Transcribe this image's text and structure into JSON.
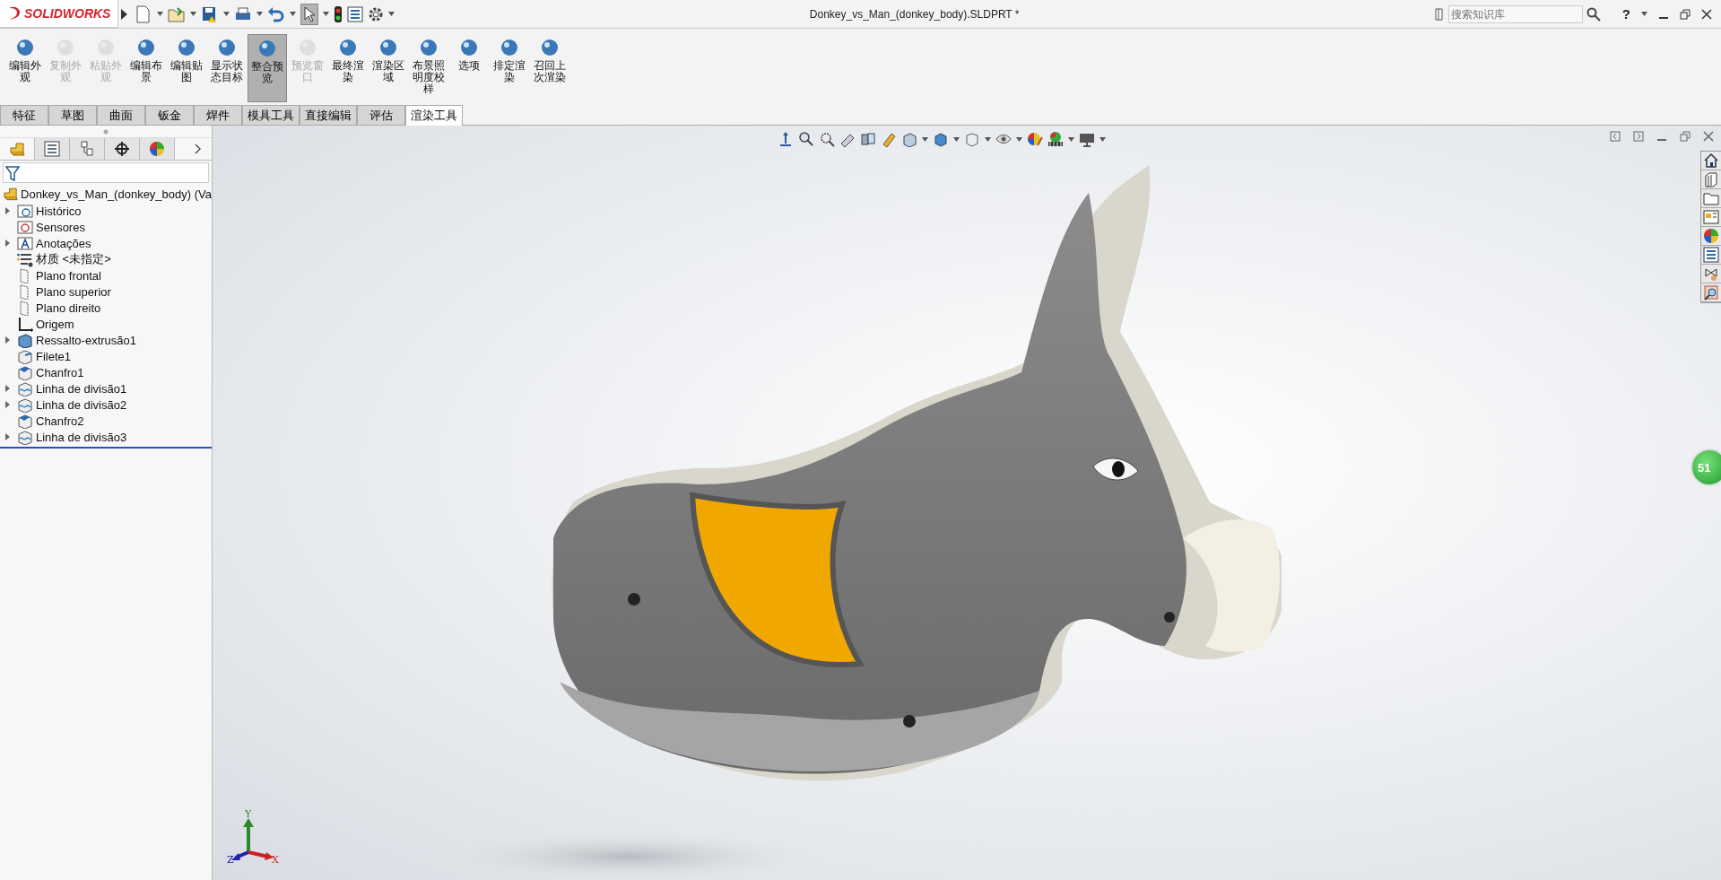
{
  "titlebar": {
    "logo": "SOLIDWORKS",
    "document_title": "Donkey_vs_Man_(donkey_body).SLDPRT *",
    "search": {
      "placeholder": "搜索知识库"
    },
    "help": "?"
  },
  "ribbon": {
    "buttons": [
      {
        "label": "编辑外观",
        "disabled": false,
        "selected": false
      },
      {
        "label": "复制外观",
        "disabled": true,
        "selected": false
      },
      {
        "label": "粘贴外观",
        "disabled": true,
        "selected": false
      },
      {
        "label": "编辑布景",
        "disabled": false,
        "selected": false
      },
      {
        "label": "编辑贴图",
        "disabled": false,
        "selected": false
      },
      {
        "label": "显示状态目标",
        "disabled": false,
        "selected": false
      },
      {
        "label": "整合预览",
        "disabled": false,
        "selected": true
      },
      {
        "label": "预览窗口",
        "disabled": true,
        "selected": false
      },
      {
        "label": "最终渲染",
        "disabled": false,
        "selected": false
      },
      {
        "label": "渲染区域",
        "disabled": false,
        "selected": false
      },
      {
        "label": "布景照明度校样",
        "disabled": false,
        "selected": false
      },
      {
        "label": "选项",
        "disabled": false,
        "selected": false
      },
      {
        "label": "排定渲染",
        "disabled": false,
        "selected": false
      },
      {
        "label": "召回上次渲染",
        "disabled": false,
        "selected": false
      }
    ]
  },
  "tabs": [
    {
      "label": "特征",
      "selected": false
    },
    {
      "label": "草图",
      "selected": false
    },
    {
      "label": "曲面",
      "selected": false
    },
    {
      "label": "钣金",
      "selected": false
    },
    {
      "label": "焊件",
      "selected": false
    },
    {
      "label": "模具工具",
      "selected": false
    },
    {
      "label": "直接编辑",
      "selected": false
    },
    {
      "label": "评估",
      "selected": false
    },
    {
      "label": "渲染工具",
      "selected": true
    }
  ],
  "feature_tree": {
    "panel_tabs": [
      {
        "selected": true
      },
      {
        "selected": false
      },
      {
        "selected": false
      },
      {
        "selected": false
      },
      {
        "selected": false
      }
    ],
    "root": "Donkey_vs_Man_(donkey_body)  (Va",
    "items": [
      {
        "label": "Histórico",
        "kind": "history",
        "expandable": true
      },
      {
        "label": "Sensores",
        "kind": "sensor",
        "expandable": false
      },
      {
        "label": "Anotações",
        "kind": "annotation",
        "expandable": true
      },
      {
        "label": "材质 <未指定>",
        "kind": "material",
        "expandable": false
      },
      {
        "label": "Plano frontal",
        "kind": "plane",
        "expandable": false
      },
      {
        "label": "Plano superior",
        "kind": "plane",
        "expandable": false
      },
      {
        "label": "Plano direito",
        "kind": "plane",
        "expandable": false
      },
      {
        "label": "Origem",
        "kind": "origin",
        "expandable": false
      },
      {
        "label": "Ressalto-extrusão1",
        "kind": "extrude",
        "expandable": true
      },
      {
        "label": "Filete1",
        "kind": "fillet",
        "expandable": false
      },
      {
        "label": "Chanfro1",
        "kind": "chamfer",
        "expandable": false
      },
      {
        "label": "Linha de divisão1",
        "kind": "split",
        "expandable": true
      },
      {
        "label": "Linha de divisão2",
        "kind": "split",
        "expandable": true
      },
      {
        "label": "Chanfro2",
        "kind": "chamfer",
        "expandable": false
      },
      {
        "label": "Linha de divisão3",
        "kind": "split",
        "expandable": true
      }
    ]
  },
  "viewport": {
    "triad": {
      "x": "X",
      "y": "Y",
      "z": "Z"
    },
    "badge": "51"
  }
}
